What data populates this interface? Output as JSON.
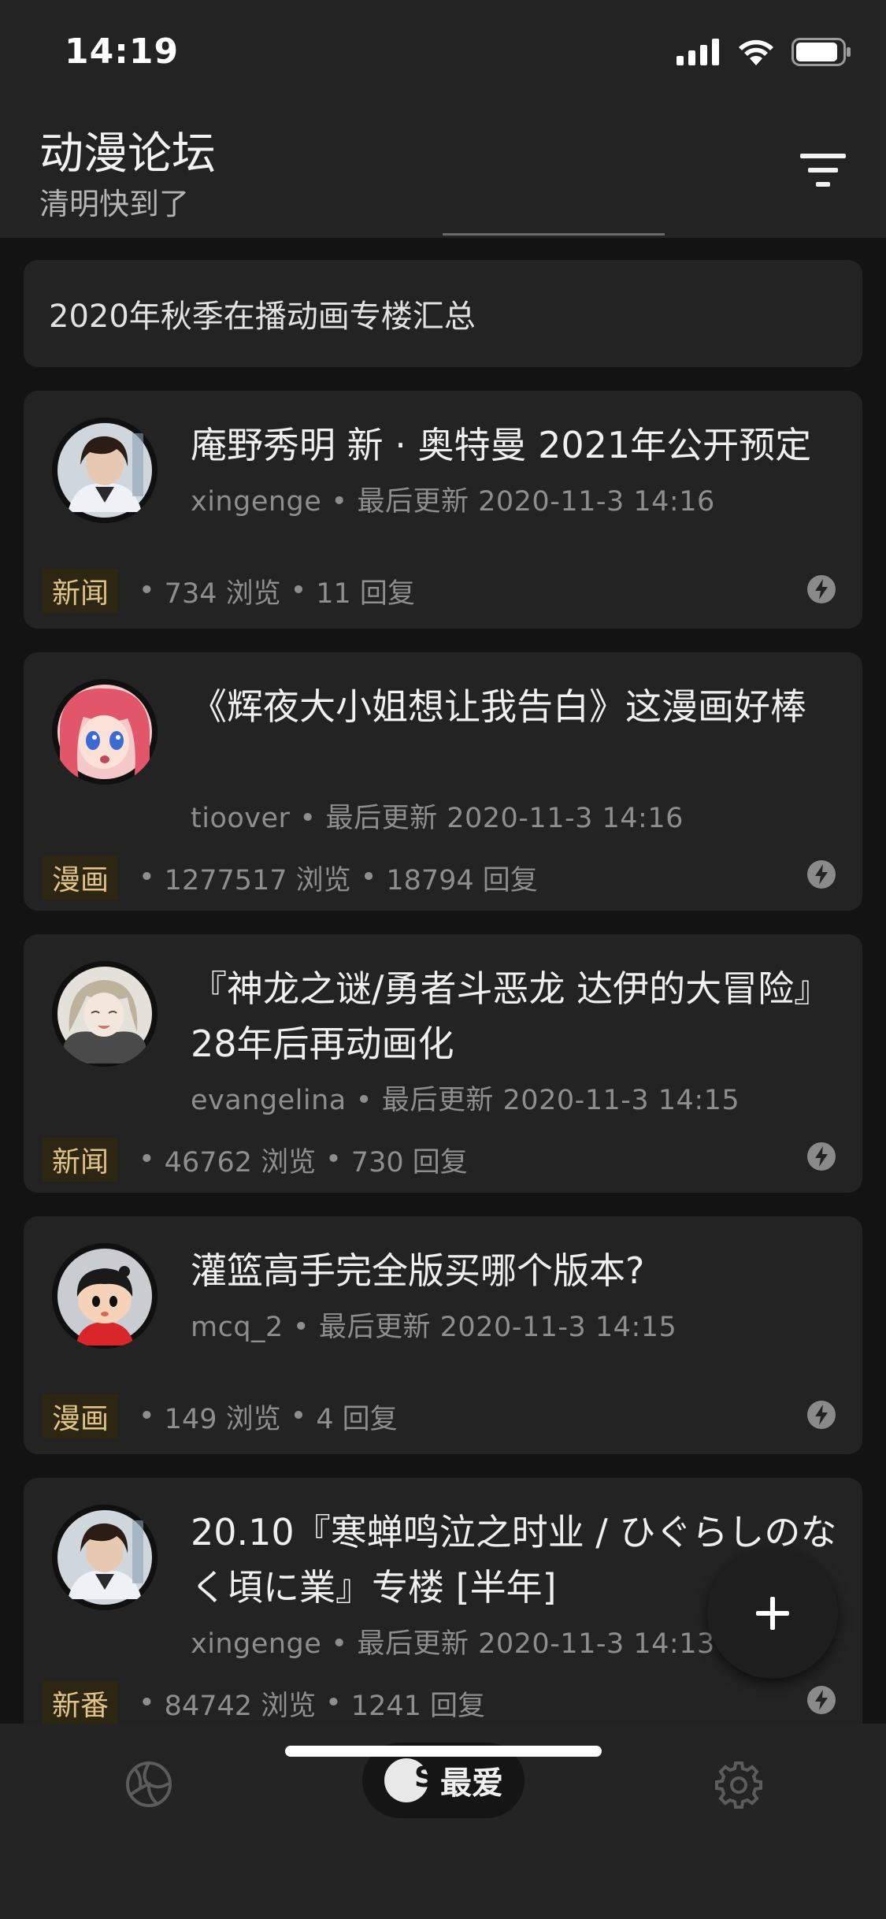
{
  "status_bar": {
    "time": "14:19"
  },
  "header": {
    "title": "动漫论坛",
    "subtitle": "清明快到了",
    "filter_icon": "filter-icon"
  },
  "pinned": {
    "text": "2020年秋季在播动画专楼汇总"
  },
  "posts": [
    {
      "title": "庵野秀明 新 · 奥特曼 2021年公开预定",
      "author": "xingenge",
      "updated_label": "最后更新",
      "updated": "2020-11-3 14:16",
      "tag": "新闻",
      "views": "734 浏览",
      "replies": "11 回复",
      "avatar": "man-portrait"
    },
    {
      "title": "《辉夜大小姐想让我告白》这漫画好棒",
      "author": "tioover",
      "updated_label": "最后更新",
      "updated": "2020-11-3 14:16",
      "tag": "漫画",
      "views": "1277517 浏览",
      "replies": "18794 回复",
      "avatar": "anime-girl-red"
    },
    {
      "title": "『神龙之谜/勇者斗恶龙 达伊的大冒险』28年后再动画化",
      "author": "evangelina",
      "updated_label": "最后更新",
      "updated": "2020-11-3 14:15",
      "tag": "新闻",
      "views": "46762 浏览",
      "replies": "730 回复",
      "avatar": "anime-girl-grey"
    },
    {
      "title": "灌篮高手完全版买哪个版本?",
      "author": "mcq_2",
      "updated_label": "最后更新",
      "updated": "2020-11-3 14:15",
      "tag": "漫画",
      "views": "149 浏览",
      "replies": "4 回复",
      "avatar": "cartoon-boy"
    },
    {
      "title": "20.10『寒蝉鸣泣之时业 / ひぐらしのなく頃に業』专楼 [半年]",
      "author": "xingenge",
      "updated_label": "最后更新",
      "updated": "2020-11-3 14:13",
      "tag": "新番",
      "views": "84742 浏览",
      "replies": "1241 回复",
      "avatar": "man-portrait"
    }
  ],
  "fab": {
    "icon": "plus-icon"
  },
  "bottom_nav": {
    "left_icon": "volleyball-icon",
    "center_label": "最爱",
    "center_badge": "S",
    "right_icon": "gear-icon"
  },
  "colors": {
    "background": "#131313",
    "card": "#232323",
    "tag_background": "#2d2612",
    "tag_text": "#e0c48a"
  }
}
